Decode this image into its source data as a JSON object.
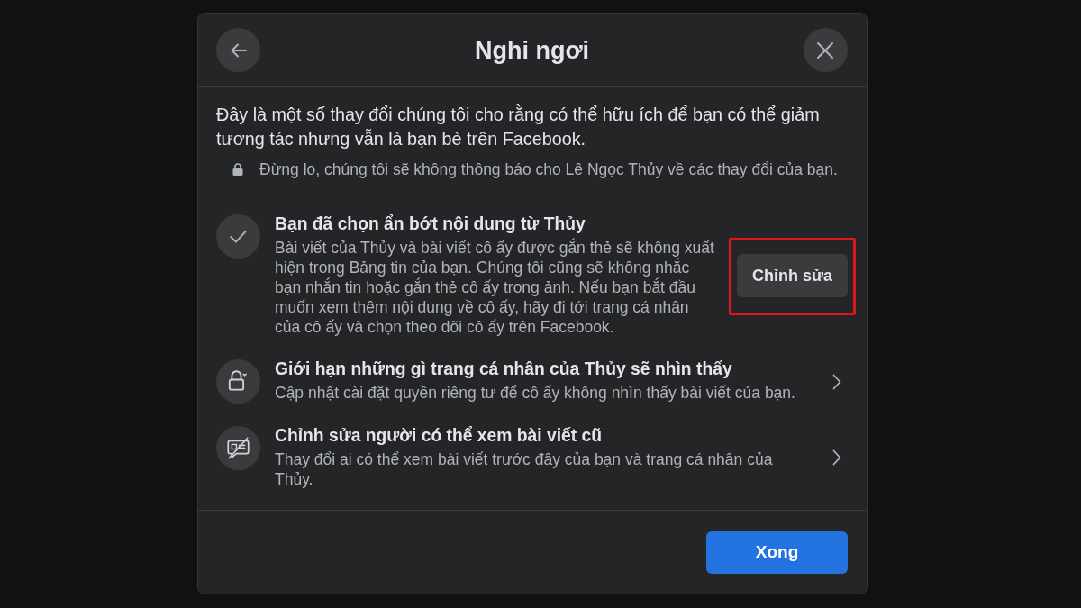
{
  "dialog": {
    "title": "Nghi ngơi",
    "intro": "Đây là một số thay đổi chúng tôi cho rằng có thể hữu ích để bạn có thể giảm tương tác nhưng vẫn là bạn bè trên Facebook.",
    "privacy_note": "Đừng lo, chúng tôi sẽ không thông báo cho Lê Ngọc Thủy về các thay đổi của bạn.",
    "options": [
      {
        "kind": "status",
        "title": "Bạn đã chọn ẩn bớt nội dung từ Thủy",
        "description": "Bài viết của Thủy và bài viết cô ấy được gắn thẻ sẽ không xuất hiện trong Bảng tin của bạn. Chúng tôi cũng sẽ không nhắc bạn nhắn tin hoặc gắn thẻ cô ấy trong ảnh. Nếu bạn bắt đầu muốn xem thêm nội dung về cô ấy, hãy đi tới trang cá nhân của cô ấy và chọn theo dõi cô ấy trên Facebook.",
        "button": {
          "label": "Chỉnh sửa",
          "highlighted": true
        }
      },
      {
        "kind": "link",
        "title": "Giới hạn những gì trang cá nhân của Thủy sẽ nhìn thấy",
        "description": "Cập nhật cài đặt quyền riêng tư để cô ấy không nhìn thấy bài viết của bạn."
      },
      {
        "kind": "link",
        "title": "Chỉnh sửa người có thể xem bài viết cũ",
        "description": "Thay đổi ai có thể xem bài viết trước đây của bạn và trang cá nhân của Thủy."
      }
    ],
    "done_button": "Xong"
  }
}
